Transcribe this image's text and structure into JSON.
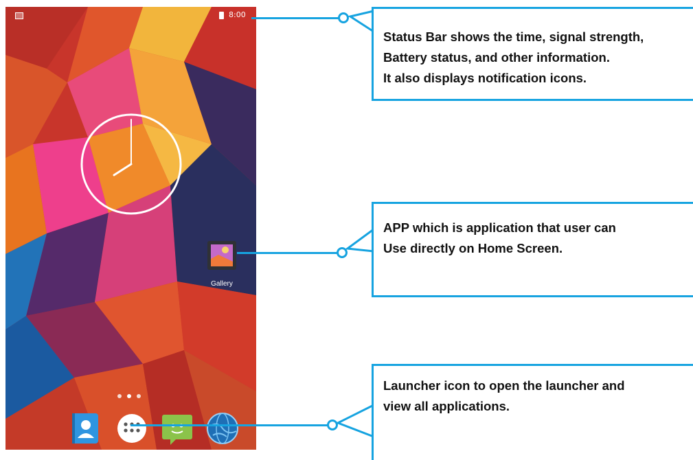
{
  "status_bar": {
    "time": "8:00"
  },
  "home_screen": {
    "apps": [
      {
        "label": "Gallery"
      }
    ],
    "page_indicator_count": 3,
    "dock": [
      {
        "icon": "contacts-icon"
      },
      {
        "icon": "launcher-icon"
      },
      {
        "icon": "messaging-icon"
      },
      {
        "icon": "browser-globe-icon"
      }
    ]
  },
  "callouts": [
    {
      "lines": [
        "Status Bar shows the time, signal strength,",
        "Battery status, and other information.",
        "It also displays notification icons."
      ]
    },
    {
      "lines": [
        "APP which is application that user can",
        "Use directly on Home Screen."
      ]
    },
    {
      "lines": [
        "Launcher icon to open the launcher and",
        "view all applications."
      ]
    }
  ],
  "colors": {
    "callout_accent": "#16a3e0",
    "status_text": "#ffffff"
  }
}
